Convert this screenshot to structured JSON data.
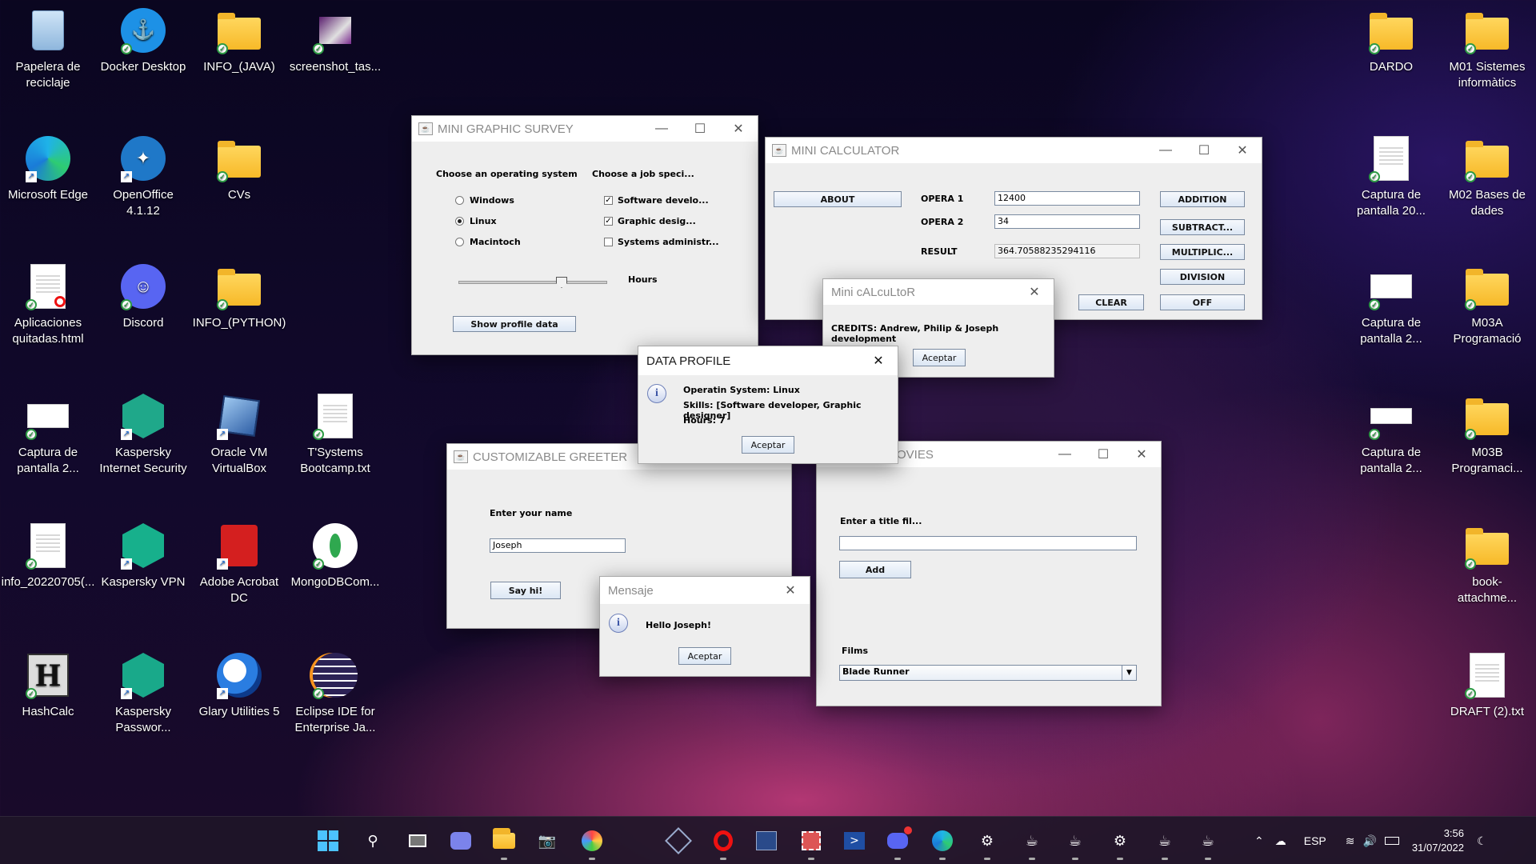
{
  "desktop_left": [
    {
      "label": "Papelera de reciclaje"
    },
    {
      "label": "Docker Desktop"
    },
    {
      "label": "INFO_(JAVA)"
    },
    {
      "label": "screenshot_tas..."
    },
    {
      "label": "Microsoft Edge"
    },
    {
      "label": "OpenOffice 4.1.12"
    },
    {
      "label": "CVs"
    },
    {
      "label": "Aplicaciones quitadas.html"
    },
    {
      "label": "Discord"
    },
    {
      "label": "INFO_(PYTHON)"
    },
    {
      "label": "Captura de pantalla 2..."
    },
    {
      "label": "Kaspersky Internet Security"
    },
    {
      "label": "Oracle VM VirtualBox"
    },
    {
      "label": "T'Systems Bootcamp.txt"
    },
    {
      "label": "info_20220705(..."
    },
    {
      "label": "Kaspersky VPN"
    },
    {
      "label": "Adobe Acrobat DC"
    },
    {
      "label": "MongoDBCom..."
    },
    {
      "label": "HashCalc"
    },
    {
      "label": "Kaspersky Passwor..."
    },
    {
      "label": "Glary Utilities 5"
    },
    {
      "label": "Eclipse IDE for Enterprise Ja..."
    }
  ],
  "desktop_right": [
    {
      "label": "DARDO"
    },
    {
      "label": "M01 Sistemes informàtics"
    },
    {
      "label": "Captura de pantalla 20..."
    },
    {
      "label": "M02 Bases de dades"
    },
    {
      "label": "Captura de pantalla 2..."
    },
    {
      "label": "M03A Programació"
    },
    {
      "label": "Captura de pantalla 2..."
    },
    {
      "label": "M03B Programaci..."
    },
    {
      "label": "book-attachme..."
    },
    {
      "label": "DRAFT (2).txt"
    }
  ],
  "survey": {
    "title": "MINI GRAPHIC SURVEY",
    "os_label": "Choose an operating system",
    "job_label": "Choose a job speci...",
    "os_options": [
      "Windows",
      "Linux",
      "Macintoch"
    ],
    "os_selected": "Linux",
    "jobs": [
      {
        "label": "Software develo...",
        "checked": true
      },
      {
        "label": "Graphic desig...",
        "checked": true
      },
      {
        "label": "Systems administr...",
        "checked": false
      }
    ],
    "hours_label": "Hours",
    "hours_value": 7,
    "show_button": "Show profile data"
  },
  "calculator": {
    "title": "MINI CALCULATOR",
    "about": "ABOUT",
    "op1_label": "OPERA 1",
    "op1_value": "12400",
    "op2_label": "OPERA 2",
    "op2_value": "34",
    "result_label": "RESULT",
    "result_value": "364.70588235294116",
    "buttons": [
      "ADDITION",
      "SUBTRACT...",
      "MULTIPLIC...",
      "DIVISION",
      "OFF"
    ],
    "clear": "CLEAR"
  },
  "credits_dialog": {
    "title": "Mini cALcuLtoR",
    "text": "CREDITS: Andrew, Philip & Joseph development",
    "button": "Aceptar"
  },
  "profile_dialog": {
    "title": "DATA PROFILE",
    "line1": "Operatin System: Linux",
    "line2": "Skills: [Software developer, Graphic designer]",
    "line3": "Hours: 7",
    "button": "Aceptar"
  },
  "greeter": {
    "title": "CUSTOMIZABLE GREETER",
    "prompt": "Enter your name",
    "name_value": "Joseph",
    "button": "Say hi!"
  },
  "message_dialog": {
    "title": "Mensaje",
    "text": "Hello Joseph!",
    "button": "Aceptar"
  },
  "movies": {
    "title_visible": "OVIES",
    "prompt": "Enter a title fil...",
    "add": "Add",
    "films_label": "Films",
    "selected_film": "Blade Runner"
  },
  "taskbar": {
    "lang": "ESP",
    "time": "3:56",
    "date": "31/07/2022"
  }
}
